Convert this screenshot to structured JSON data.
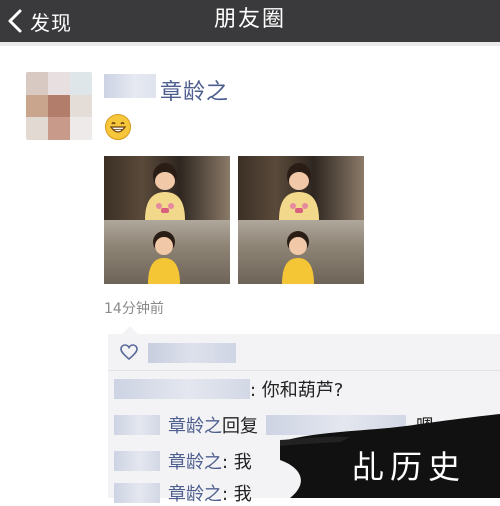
{
  "nav": {
    "back_label": "发现",
    "title": "朋友圈"
  },
  "post": {
    "author_name": "章龄之",
    "time": "14分钟前",
    "emoji_icon": "grinning-face-icon",
    "photo_count": 4
  },
  "comments": {
    "like_icon": "heart-outline-icon",
    "rows": [
      {
        "text": ": 你和葫芦?"
      },
      {
        "name": "章龄之",
        "reply_word": "回复",
        "tail": "嗯"
      },
      {
        "name": "章龄之",
        "tail": ": 我"
      },
      {
        "name": "章龄之",
        "tail": ": 我"
      }
    ]
  },
  "watermark": {
    "text": "乩历史"
  },
  "colors": {
    "nav_bg": "#3a3a3c",
    "name_blue": "#4e5f8f",
    "comment_bg": "#f3f3f5"
  }
}
